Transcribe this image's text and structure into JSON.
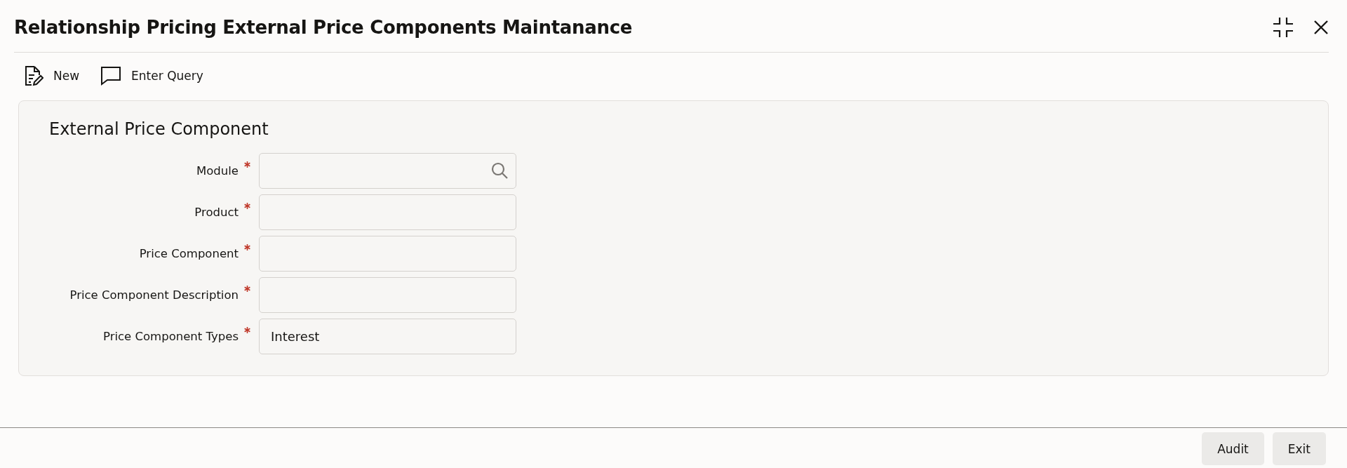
{
  "window": {
    "title": "Relationship Pricing External Price Components Maintanance"
  },
  "toolbar": [
    {
      "kind": "new",
      "label": "New"
    },
    {
      "kind": "query",
      "label": "Enter Query"
    }
  ],
  "section": {
    "title": "External Price Component",
    "fields": [
      {
        "label": "Module",
        "required": true,
        "kind": "search"
      },
      {
        "label": "Product",
        "required": true,
        "kind": "text"
      },
      {
        "label": "Price Component",
        "required": true,
        "kind": "text"
      },
      {
        "label": "Price Component Description",
        "required": true,
        "kind": "text"
      },
      {
        "label": "Price Component Types",
        "required": true,
        "kind": "text",
        "value": "Interest"
      }
    ]
  },
  "buttons": [
    "Audit",
    "Exit"
  ]
}
